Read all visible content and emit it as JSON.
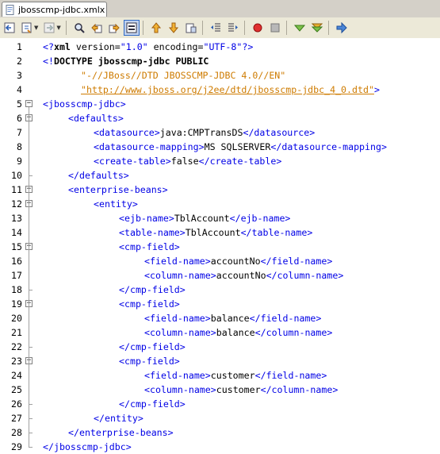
{
  "tab": {
    "file_name": "jbosscmp-jdbc.xml",
    "close_glyph": "x"
  },
  "toolbar": {
    "icons": [
      "back-icon",
      "history-icon",
      "forward-icon",
      "find-icon",
      "find-previous-icon",
      "find-next-icon",
      "toggle-highlight-icon",
      "previous-bookmark-icon",
      "next-bookmark-icon",
      "toggle-bookmark-icon",
      "shift-left-icon",
      "shift-right-icon",
      "record-macro-icon",
      "stop-macro-icon",
      "comment-icon",
      "uncomment-icon",
      "run-icon"
    ]
  },
  "editor": {
    "lines": [
      {
        "n": "1",
        "indent": 0,
        "tokens": [
          {
            "c": "tag",
            "t": "<?"
          },
          {
            "c": "kw",
            "t": "xml"
          },
          {
            "c": "txt",
            "t": " version="
          },
          {
            "c": "tag",
            "t": "\"1.0\""
          },
          {
            "c": "txt",
            "t": " encoding="
          },
          {
            "c": "tag",
            "t": "\"UTF-8\""
          },
          {
            "c": "tag",
            "t": "?>"
          }
        ]
      },
      {
        "n": "2",
        "indent": 0,
        "tokens": [
          {
            "c": "tag",
            "t": "<!"
          },
          {
            "c": "kw",
            "t": "DOCTYPE jbosscmp-jdbc PUBLIC"
          }
        ]
      },
      {
        "n": "3",
        "indent": 6,
        "tokens": [
          {
            "c": "str",
            "t": "\"-//JBoss//DTD JBOSSCMP-JDBC 4.0//EN\""
          }
        ]
      },
      {
        "n": "4",
        "indent": 6,
        "tokens": [
          {
            "c": "url",
            "t": "\"http://www.jboss.org/j2ee/dtd/jbosscmp-jdbc_4_0.dtd\""
          },
          {
            "c": "tag",
            "t": ">"
          }
        ]
      },
      {
        "n": "5",
        "indent": 0,
        "tokens": [
          {
            "c": "tag",
            "t": "<jbosscmp-jdbc>"
          }
        ]
      },
      {
        "n": "6",
        "indent": 4,
        "tokens": [
          {
            "c": "tag",
            "t": "<defaults>"
          }
        ]
      },
      {
        "n": "7",
        "indent": 8,
        "tokens": [
          {
            "c": "tag",
            "t": "<datasource>"
          },
          {
            "c": "txt",
            "t": "java:CMPTransDS"
          },
          {
            "c": "tag",
            "t": "</datasource>"
          }
        ]
      },
      {
        "n": "8",
        "indent": 8,
        "tokens": [
          {
            "c": "tag",
            "t": "<datasource-mapping>"
          },
          {
            "c": "txt",
            "t": "MS SQLSERVER"
          },
          {
            "c": "tag",
            "t": "</datasource-mapping>"
          }
        ]
      },
      {
        "n": "9",
        "indent": 8,
        "tokens": [
          {
            "c": "tag",
            "t": "<create-table>"
          },
          {
            "c": "txt",
            "t": "false"
          },
          {
            "c": "tag",
            "t": "</create-table>"
          }
        ]
      },
      {
        "n": "10",
        "indent": 4,
        "tokens": [
          {
            "c": "tag",
            "t": "</defaults>"
          }
        ]
      },
      {
        "n": "11",
        "indent": 4,
        "tokens": [
          {
            "c": "tag",
            "t": "<enterprise-beans>"
          }
        ]
      },
      {
        "n": "12",
        "indent": 8,
        "tokens": [
          {
            "c": "tag",
            "t": "<entity>"
          }
        ]
      },
      {
        "n": "13",
        "indent": 12,
        "tokens": [
          {
            "c": "tag",
            "t": "<ejb-name>"
          },
          {
            "c": "txt",
            "t": "TblAccount"
          },
          {
            "c": "tag",
            "t": "</ejb-name>"
          }
        ]
      },
      {
        "n": "14",
        "indent": 12,
        "tokens": [
          {
            "c": "tag",
            "t": "<table-name>"
          },
          {
            "c": "txt",
            "t": "TblAccount"
          },
          {
            "c": "tag",
            "t": "</table-name>"
          }
        ]
      },
      {
        "n": "15",
        "indent": 12,
        "tokens": [
          {
            "c": "tag",
            "t": "<cmp-field>"
          }
        ]
      },
      {
        "n": "16",
        "indent": 16,
        "tokens": [
          {
            "c": "tag",
            "t": "<field-name>"
          },
          {
            "c": "txt",
            "t": "accountNo"
          },
          {
            "c": "tag",
            "t": "</field-name>"
          }
        ]
      },
      {
        "n": "17",
        "indent": 16,
        "tokens": [
          {
            "c": "tag",
            "t": "<column-name>"
          },
          {
            "c": "txt",
            "t": "accountNo"
          },
          {
            "c": "tag",
            "t": "</column-name>"
          }
        ]
      },
      {
        "n": "18",
        "indent": 12,
        "tokens": [
          {
            "c": "tag",
            "t": "</cmp-field>"
          }
        ]
      },
      {
        "n": "19",
        "indent": 12,
        "tokens": [
          {
            "c": "tag",
            "t": "<cmp-field>"
          }
        ]
      },
      {
        "n": "20",
        "indent": 16,
        "tokens": [
          {
            "c": "tag",
            "t": "<field-name>"
          },
          {
            "c": "txt",
            "t": "balance"
          },
          {
            "c": "tag",
            "t": "</field-name>"
          }
        ]
      },
      {
        "n": "21",
        "indent": 16,
        "tokens": [
          {
            "c": "tag",
            "t": "<column-name>"
          },
          {
            "c": "txt",
            "t": "balance"
          },
          {
            "c": "tag",
            "t": "</column-name>"
          }
        ]
      },
      {
        "n": "22",
        "indent": 12,
        "tokens": [
          {
            "c": "tag",
            "t": "</cmp-field>"
          }
        ]
      },
      {
        "n": "23",
        "indent": 12,
        "tokens": [
          {
            "c": "tag",
            "t": "<cmp-field>"
          }
        ]
      },
      {
        "n": "24",
        "indent": 16,
        "tokens": [
          {
            "c": "tag",
            "t": "<field-name>"
          },
          {
            "c": "txt",
            "t": "customer"
          },
          {
            "c": "tag",
            "t": "</field-name>"
          }
        ]
      },
      {
        "n": "25",
        "indent": 16,
        "tokens": [
          {
            "c": "tag",
            "t": "<column-name>"
          },
          {
            "c": "txt",
            "t": "customer"
          },
          {
            "c": "tag",
            "t": "</column-name>"
          }
        ]
      },
      {
        "n": "26",
        "indent": 12,
        "tokens": [
          {
            "c": "tag",
            "t": "</cmp-field>"
          }
        ]
      },
      {
        "n": "27",
        "indent": 8,
        "tokens": [
          {
            "c": "tag",
            "t": "</entity>"
          }
        ]
      },
      {
        "n": "28",
        "indent": 4,
        "tokens": [
          {
            "c": "tag",
            "t": "</enterprise-beans>"
          }
        ]
      },
      {
        "n": "29",
        "indent": 0,
        "tokens": [
          {
            "c": "tag",
            "t": "</jbosscmp-jdbc>"
          }
        ]
      }
    ],
    "folds": [
      {
        "line": "5",
        "kind": "open"
      },
      {
        "line": "6",
        "kind": "open"
      },
      {
        "line": "10",
        "kind": "close"
      },
      {
        "line": "11",
        "kind": "open"
      },
      {
        "line": "12",
        "kind": "open"
      },
      {
        "line": "15",
        "kind": "open"
      },
      {
        "line": "18",
        "kind": "close"
      },
      {
        "line": "19",
        "kind": "open"
      },
      {
        "line": "22",
        "kind": "close"
      },
      {
        "line": "23",
        "kind": "open"
      },
      {
        "line": "26",
        "kind": "close"
      },
      {
        "line": "27",
        "kind": "close"
      },
      {
        "line": "28",
        "kind": "close"
      },
      {
        "line": "29",
        "kind": "close"
      }
    ]
  },
  "colors": {
    "tag": "#0000e6",
    "string": "#ce7b00",
    "text": "#000000"
  }
}
